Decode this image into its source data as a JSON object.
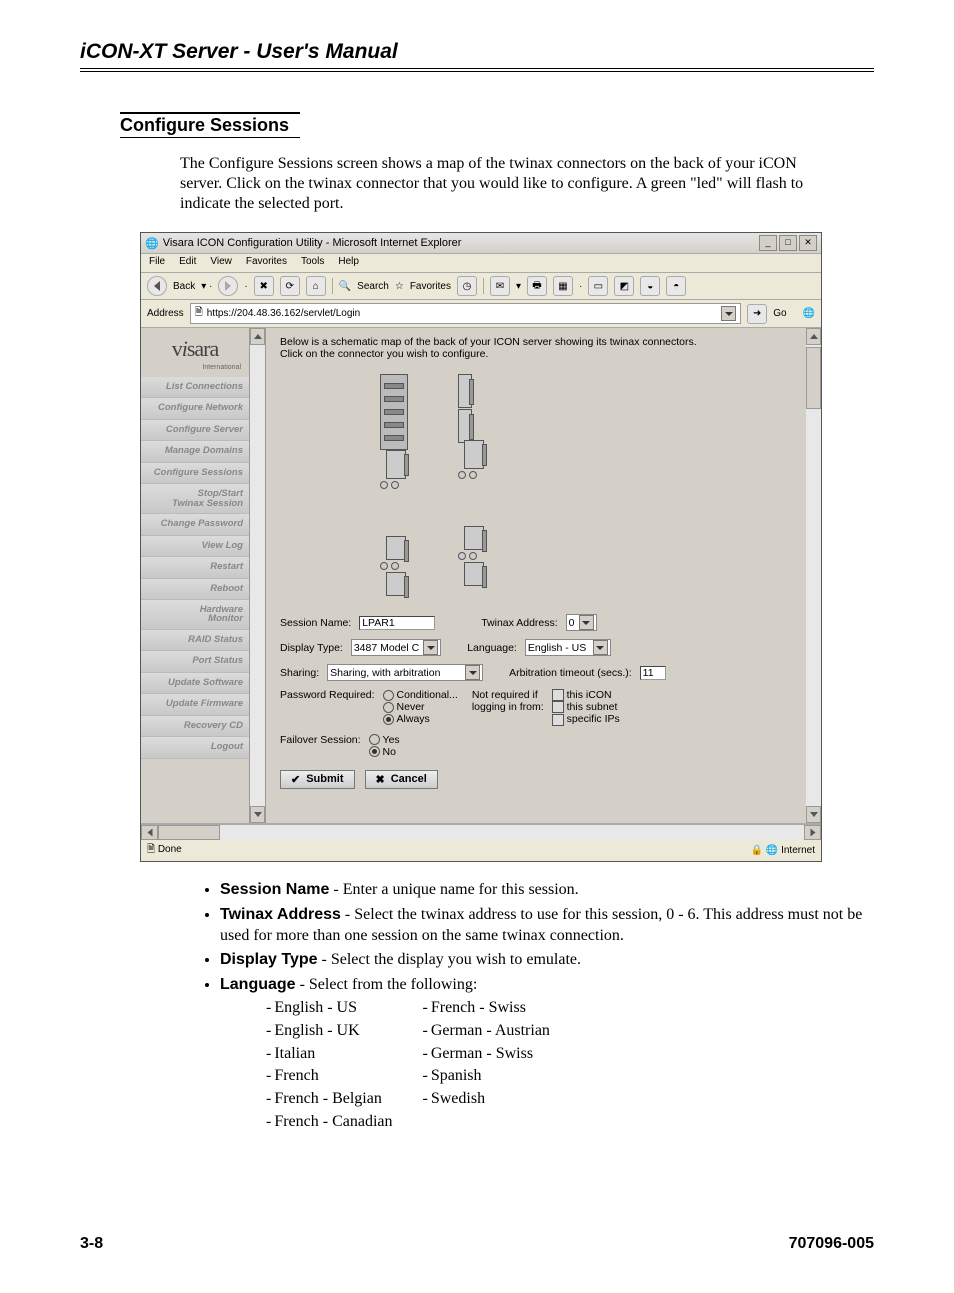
{
  "doc_title": "iCON-XT Server - User's Manual",
  "section_title": "Configure Sessions",
  "intro": "The Configure Sessions screen shows a map of the twinax connectors on the back of your iCON server. Click on the twinax connector that you would like to configure. A green \"led\" will flash to indicate the selected port.",
  "window": {
    "title": "Visara ICON Configuration Utility - Microsoft Internet Explorer",
    "menu": {
      "file": "File",
      "edit": "Edit",
      "view": "View",
      "favorites": "Favorites",
      "tools": "Tools",
      "help": "Help"
    },
    "toolbar": {
      "back": "Back",
      "search": "Search",
      "favorites": "Favorites"
    },
    "addr_label": "Address",
    "addr_value": "https://204.48.36.162/servlet/Login",
    "go": "Go",
    "logo_text": "visara",
    "logo_sub": "International",
    "nav": [
      "List Connections",
      "Configure Network",
      "Configure Server",
      "Manage Domains",
      "Configure Sessions",
      "Stop/Start Twinax Session",
      "Change Password",
      "View Log",
      "Restart",
      "Reboot",
      "Hardware Monitor",
      "RAID Status",
      "Port Status",
      "Update Software",
      "Update Firmware",
      "Recovery CD",
      "Logout"
    ],
    "panel_intro_1": "Below is a schematic map of the back of your ICON server showing its twinax connectors.",
    "panel_intro_2": "Click on the connector you wish to configure.",
    "session_name_label": "Session Name:",
    "session_name_value": "LPAR1",
    "twinax_addr_label": "Twinax Address:",
    "twinax_addr_value": "0",
    "display_type_label": "Display Type:",
    "display_type_value": "3487 Model C",
    "language_label": "Language:",
    "language_value": "English - US",
    "sharing_label": "Sharing:",
    "sharing_value": "Sharing, with arbitration",
    "arb_label": "Arbitration timeout (secs.):",
    "arb_value": "11",
    "pwd_req_label": "Password Required:",
    "pwd_cond": "Conditional...",
    "pwd_never": "Never",
    "pwd_always": "Always",
    "not_req_label": "Not required if logging in from:",
    "nr_icon": "this iCON",
    "nr_subnet": "this subnet",
    "nr_ips": "specific IPs",
    "failover_label": "Failover Session:",
    "fo_yes": "Yes",
    "fo_no": "No",
    "submit": "Submit",
    "cancel": "Cancel",
    "status_done": "Done",
    "status_zone": "Internet"
  },
  "bullets": {
    "session_name_label": "Session Name",
    "session_name_text": " - Enter a unique name for this session.",
    "twinax_label": "Twinax Address",
    "twinax_text": " - Select the twinax address to use for this session, 0 - 6. This address must not be used for more than one session on the same twinax connection.",
    "display_type_label": "Display Type",
    "display_type_text": " - Select the display you wish to emulate.",
    "language_label": "Language",
    "language_text": " - Select from the following:",
    "langs_col1": [
      "English - US",
      "English - UK",
      "Italian",
      "French",
      "French - Belgian",
      "French - Canadian"
    ],
    "langs_col2": [
      "French - Swiss",
      "German - Austrian",
      "German - Swiss",
      "Spanish",
      "Swedish"
    ]
  },
  "footer_left": "3-8",
  "footer_right": "707096-005"
}
